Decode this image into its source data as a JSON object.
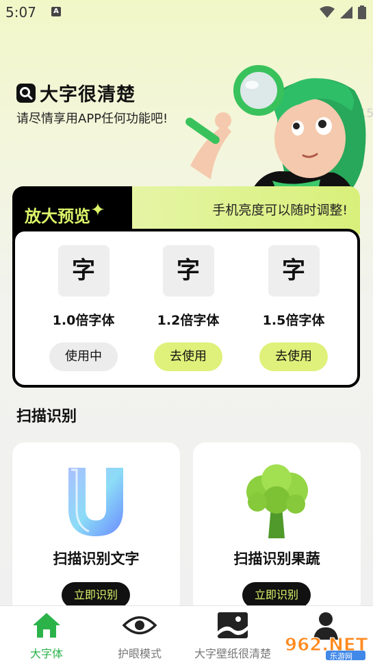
{
  "status_bar": {
    "time": "5:07",
    "notification_letter": "A",
    "icons": [
      "wifi-icon",
      "signal-icon",
      "battery-icon"
    ]
  },
  "hero": {
    "title": "大字很清楚",
    "subtitle": "请尽情享用APP任何功能吧!",
    "watermark_id": "1a0e15",
    "icons": [
      "search-magnifier-icon"
    ]
  },
  "preview": {
    "title": "放大预览",
    "tip": "手机亮度可以随时调整!",
    "options": [
      {
        "char": "字",
        "label": "1.0倍字体",
        "button": "使用中",
        "state": "current"
      },
      {
        "char": "字",
        "label": "1.2倍字体",
        "button": "去使用",
        "state": "available"
      },
      {
        "char": "字",
        "label": "1.5倍字体",
        "button": "去使用",
        "state": "available"
      }
    ]
  },
  "scan": {
    "section_title": "扫描识别",
    "cards": [
      {
        "label": "扫描识别文字",
        "button": "立即识别",
        "icon": "glass-u-icon"
      },
      {
        "label": "扫描识别果蔬",
        "button": "立即识别",
        "icon": "broccoli-icon"
      }
    ]
  },
  "bottom_nav": {
    "items": [
      {
        "label": "大字体",
        "icon": "home-icon",
        "active": true
      },
      {
        "label": "护眼模式",
        "icon": "eye-icon",
        "active": false
      },
      {
        "label": "大字壁纸很清楚",
        "icon": "wallpaper-icon",
        "active": false
      },
      {
        "label": "",
        "icon": "profile-icon",
        "active": false
      }
    ]
  },
  "watermark_logo": {
    "text": "962.NET",
    "subtext": "乐游网"
  },
  "colors": {
    "accent_lime": "#dcf56a",
    "active_green": "#2bb34a",
    "dark": "#111111"
  }
}
